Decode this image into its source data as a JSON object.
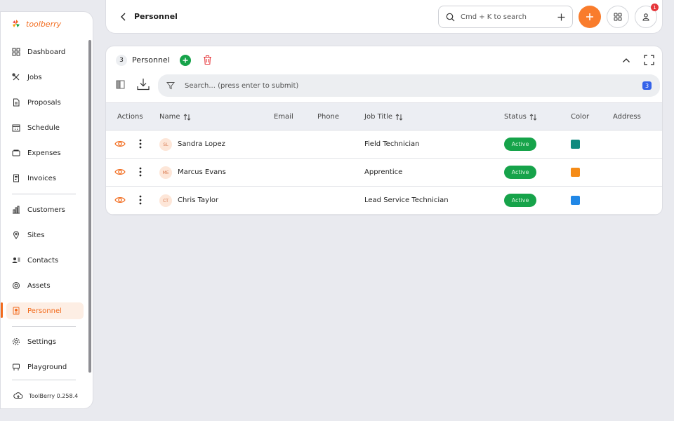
{
  "app": {
    "brand": "toolberry",
    "version": "ToolBerry 0.258.4"
  },
  "sidebar": {
    "items": [
      {
        "label": "Dashboard",
        "icon": "grid-icon"
      },
      {
        "label": "Jobs",
        "icon": "tools-icon"
      },
      {
        "label": "Proposals",
        "icon": "document-icon"
      },
      {
        "label": "Schedule",
        "icon": "calendar-icon"
      },
      {
        "label": "Expenses",
        "icon": "wallet-icon"
      },
      {
        "label": "Invoices",
        "icon": "invoice-icon"
      },
      {
        "label": "Customers",
        "icon": "bar-chart-icon"
      },
      {
        "label": "Sites",
        "icon": "map-pin-icon"
      },
      {
        "label": "Contacts",
        "icon": "contacts-icon"
      },
      {
        "label": "Assets",
        "icon": "asset-icon"
      },
      {
        "label": "Personnel",
        "icon": "badge-icon",
        "active": true
      },
      {
        "label": "Settings",
        "icon": "gear-icon"
      },
      {
        "label": "Playground",
        "icon": "playground-icon"
      }
    ]
  },
  "header": {
    "title": "Personnel",
    "search_placeholder": "Cmd + K to search",
    "notification_count": "1"
  },
  "card": {
    "count": "3",
    "title": "Personnel",
    "filter_placeholder": "Search... (press enter to submit)",
    "filter_count": "3"
  },
  "table": {
    "columns": [
      "Actions",
      "Name",
      "Email",
      "Phone",
      "Job Title",
      "Status",
      "Color",
      "Address"
    ],
    "rows": [
      {
        "initials": "SL",
        "name": "Sandra Lopez",
        "email": "",
        "phone": "",
        "job_title": "Field Technician",
        "status": "Active",
        "color": "#0f8a7e",
        "address": ""
      },
      {
        "initials": "ME",
        "name": "Marcus Evans",
        "email": "",
        "phone": "",
        "job_title": "Apprentice",
        "status": "Active",
        "color": "#f58b16",
        "address": ""
      },
      {
        "initials": "CT",
        "name": "Chris Taylor",
        "email": "",
        "phone": "",
        "job_title": "Lead Service Technician",
        "status": "Active",
        "color": "#2187e6",
        "address": ""
      }
    ]
  },
  "colors": {
    "accent": "#f26b1d",
    "active_green": "#16a34a",
    "danger": "#e6373b"
  }
}
